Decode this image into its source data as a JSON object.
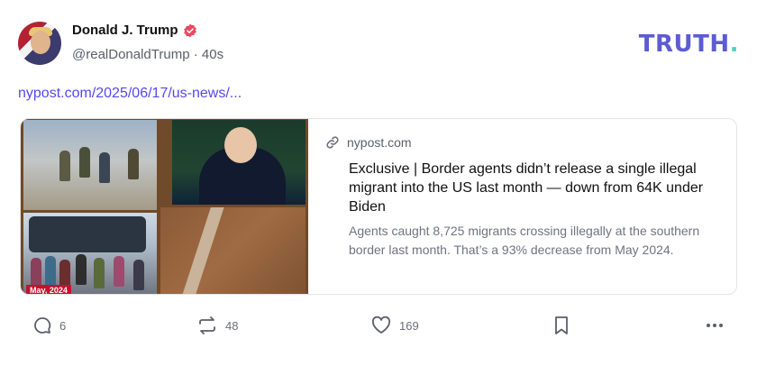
{
  "post": {
    "author": "Donald J. Trump",
    "handle_time": "@realDonaldTrump · 40s",
    "link_text": "nypost.com/2025/06/17/us-news/..."
  },
  "brand": {
    "logo_main": "TRUTH",
    "logo_dot": "."
  },
  "card": {
    "domain": "nypost.com",
    "headline": "Exclusive | Border agents didn’t release a single illegal migrant into the US last month — down from 64K under Biden",
    "description": "Agents caught 8,725 migrants crossing illegally at the southern border last month. That’s a 93% decrease from May 2024.",
    "image_badge": "May, 2024"
  },
  "actions": {
    "replies": "6",
    "retruths": "48",
    "likes": "169"
  },
  "colors": {
    "link": "#5448ee",
    "logo": "#5d5bd4",
    "logo_dot": "#45d7c4",
    "verified": "#e84a5f"
  },
  "icons": [
    "verified-badge-icon",
    "chain-link-icon",
    "reply-icon",
    "retruth-icon",
    "heart-icon",
    "bookmark-icon",
    "more-icon"
  ]
}
